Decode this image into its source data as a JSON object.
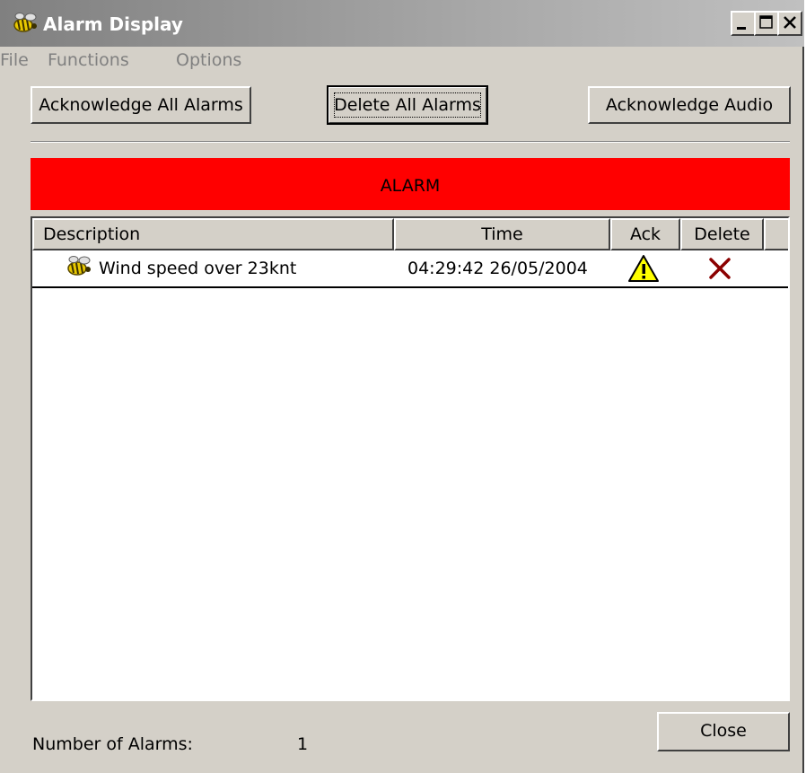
{
  "window": {
    "title": "Alarm Display",
    "app_icon": "bee-icon"
  },
  "titlebar_buttons": [
    "minimize-icon",
    "maximize-icon",
    "close-icon"
  ],
  "menu": [
    "File",
    "Functions",
    "Options"
  ],
  "toolbar": {
    "ack_all_label": "Acknowledge All Alarms",
    "delete_all_label": "Delete All Alarms",
    "ack_audio_label": "Acknowledge Audio"
  },
  "banner": {
    "text": "ALARM",
    "color": "#ff0000"
  },
  "table": {
    "columns": [
      "Description",
      "Time",
      "Ack",
      "Delete"
    ],
    "rows": [
      {
        "icon": "bee-icon",
        "description": "Wind speed over 23knt",
        "time": "04:29:42 26/05/2004",
        "ack_icon": "warning-icon",
        "delete_icon": "delete-x-icon"
      }
    ]
  },
  "footer": {
    "count_label": "Number of Alarms:",
    "count_value": "1",
    "close_label": "Close"
  }
}
